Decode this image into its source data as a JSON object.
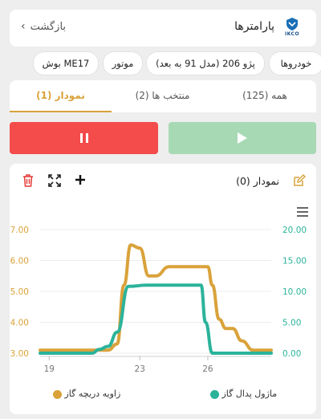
{
  "header": {
    "title": "پارامترها",
    "back_label": "بازگشت",
    "logo_text": "IKCO"
  },
  "breadcrumb": [
    "خودروها",
    "پژو 206 (مدل 91 به بعد)",
    "موتور",
    "بوش ME17"
  ],
  "tabs": [
    {
      "label": "همه (125)",
      "active": false
    },
    {
      "label": "منتخب ها (2)",
      "active": false
    },
    {
      "label": "نمودار (1)",
      "active": true
    }
  ],
  "controls": {
    "pause": "pause-icon",
    "play": "play-icon"
  },
  "chart_panel": {
    "title": "نمودار (0)",
    "icons": [
      "edit-icon",
      "add-icon",
      "fullscreen-icon",
      "delete-icon",
      "menu-icon"
    ]
  },
  "colors": {
    "accent": "#d9a23a",
    "series_left": "#d9a23a",
    "series_right": "#2bb39a",
    "pause": "#f44b4b",
    "play": "#a8d9b5",
    "delete": "#e53935"
  },
  "chart_data": {
    "type": "line",
    "x_ticks": [
      "19",
      "23",
      "26"
    ],
    "x_range": [
      18.6,
      28.8
    ],
    "left_axis": {
      "ticks": [
        "7.00",
        "6.00",
        "5.00",
        "4.00",
        "3.00"
      ],
      "range": [
        3.0,
        7.0
      ]
    },
    "right_axis": {
      "ticks": [
        "20.00",
        "15.00",
        "10.00",
        "5.00",
        "0.00"
      ],
      "range": [
        0,
        20
      ]
    },
    "series": [
      {
        "name": "زاویه دریچه گاز",
        "axis": "left",
        "points": [
          [
            18.6,
            3.1
          ],
          [
            21.6,
            3.1
          ],
          [
            22.0,
            3.3
          ],
          [
            22.3,
            5.2
          ],
          [
            22.6,
            6.5
          ],
          [
            23.0,
            6.4
          ],
          [
            23.4,
            5.5
          ],
          [
            23.7,
            5.5
          ],
          [
            24.3,
            5.8
          ],
          [
            26.0,
            5.8
          ],
          [
            26.2,
            5.2
          ],
          [
            26.5,
            4.1
          ],
          [
            26.8,
            3.8
          ],
          [
            27.1,
            3.8
          ],
          [
            27.5,
            3.4
          ],
          [
            28.0,
            3.1
          ],
          [
            28.8,
            3.1
          ]
        ]
      },
      {
        "name": "ماژول پدال گاز",
        "axis": "right",
        "points": [
          [
            18.6,
            0
          ],
          [
            20.9,
            0
          ],
          [
            21.2,
            0.6
          ],
          [
            21.6,
            1.1
          ],
          [
            22.0,
            3.4
          ],
          [
            22.5,
            10.8
          ],
          [
            23.3,
            11.0
          ],
          [
            25.7,
            11.0
          ],
          [
            25.9,
            5.0
          ],
          [
            26.2,
            0
          ],
          [
            28.8,
            0
          ]
        ]
      }
    ]
  }
}
